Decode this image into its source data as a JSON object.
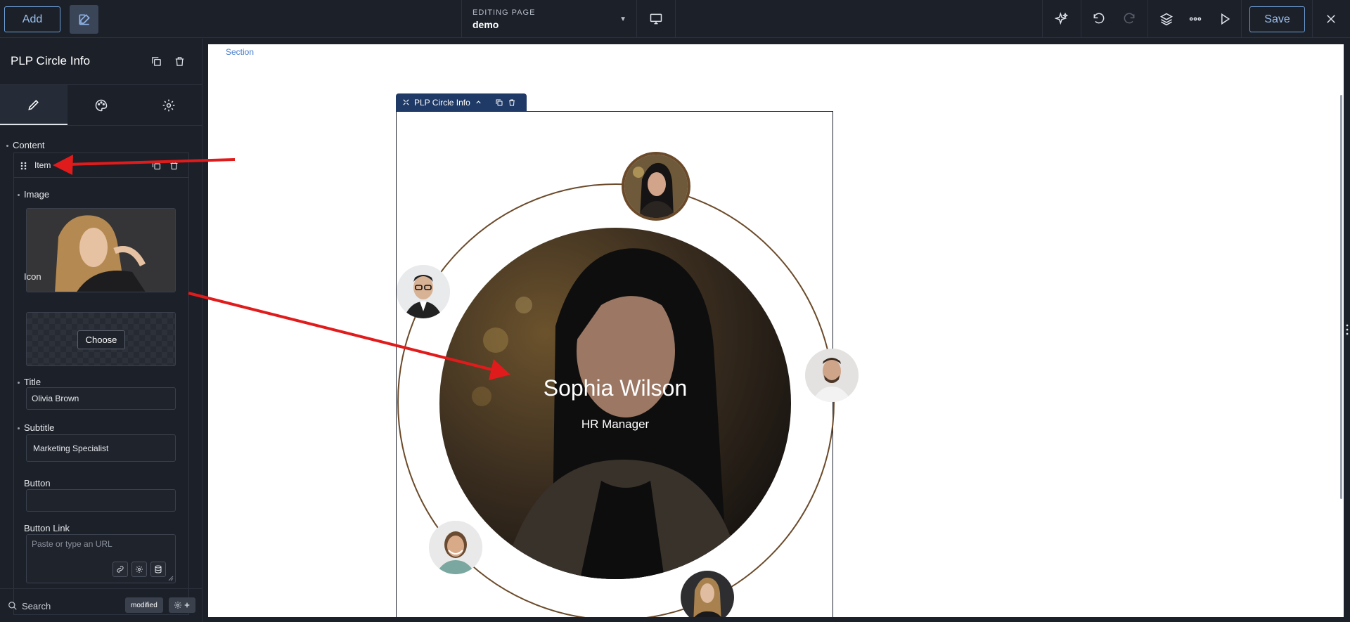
{
  "topbar": {
    "add_label": "Add",
    "editing_label": "EDITING PAGE",
    "page_name": "demo",
    "save_label": "Save"
  },
  "sidebar": {
    "title": "PLP Circle Info",
    "content_label": "Content",
    "item_label": "Item",
    "image_label": "Image",
    "icon_label": "Icon",
    "choose_label": "Choose",
    "title_label": "Title",
    "title_value": "Olivia Brown",
    "subtitle_label": "Subtitle",
    "subtitle_value": "Marketing Specialist",
    "button_label": "Button",
    "button_value": "",
    "button_link_label": "Button Link",
    "button_link_placeholder": "Paste or type an URL",
    "search_label": "Search",
    "modified_label": "modified"
  },
  "canvas": {
    "section_label": "Section",
    "widget_label": "PLP Circle Info",
    "center_name": "Sophia Wilson",
    "center_role": "HR Manager"
  },
  "colors": {
    "accent": "#6f9fd8",
    "orbit": "#6b4a2a",
    "annotation_arrow": "#e01b1b"
  }
}
